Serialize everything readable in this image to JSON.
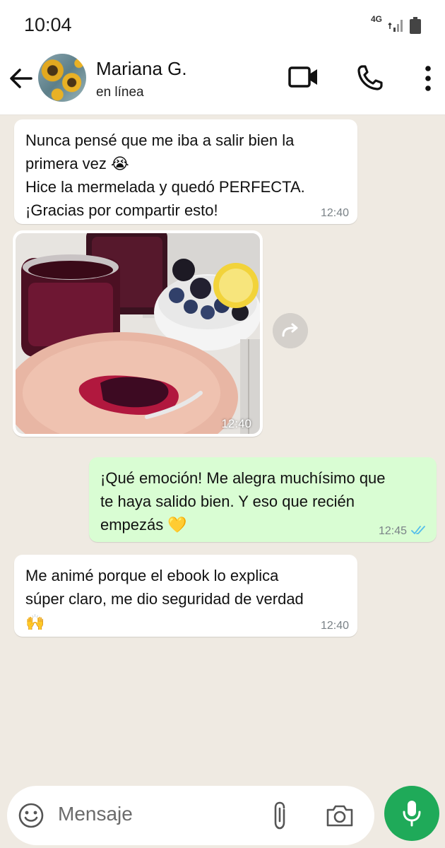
{
  "status_bar": {
    "time": "10:04",
    "network": "4G"
  },
  "header": {
    "name": "Mariana G.",
    "status": "en línea"
  },
  "messages": {
    "m1": {
      "text": "Nunca pensé que me iba a salir bien la\nprimera vez 😭\nHice la mermelada y quedó PERFECTA.\n¡Gracias por compartir esto!",
      "time": "12:40"
    },
    "m2": {
      "time": "12:40"
    },
    "m3": {
      "text": "¡Qué emoción! Me alegra muchísimo que\nte haya salido bien. Y eso que recién\nempezás 💛",
      "time": "12:45"
    },
    "m4": {
      "text": "Me animé porque el ebook lo explica\nsúper claro, me dio seguridad de verdad\n🙌",
      "time": "12:40"
    }
  },
  "input": {
    "placeholder": "Mensaje"
  },
  "colors": {
    "outgoing_bubble": "#d9fdd3",
    "read_ticks": "#53bdeb",
    "mic_button": "#1faa59",
    "background": "#efeae2"
  },
  "icons": [
    "back-arrow-icon",
    "video-call-icon",
    "phone-icon",
    "more-icon",
    "forward-icon",
    "emoji-icon",
    "attach-icon",
    "camera-icon",
    "mic-icon",
    "read-ticks-icon"
  ]
}
